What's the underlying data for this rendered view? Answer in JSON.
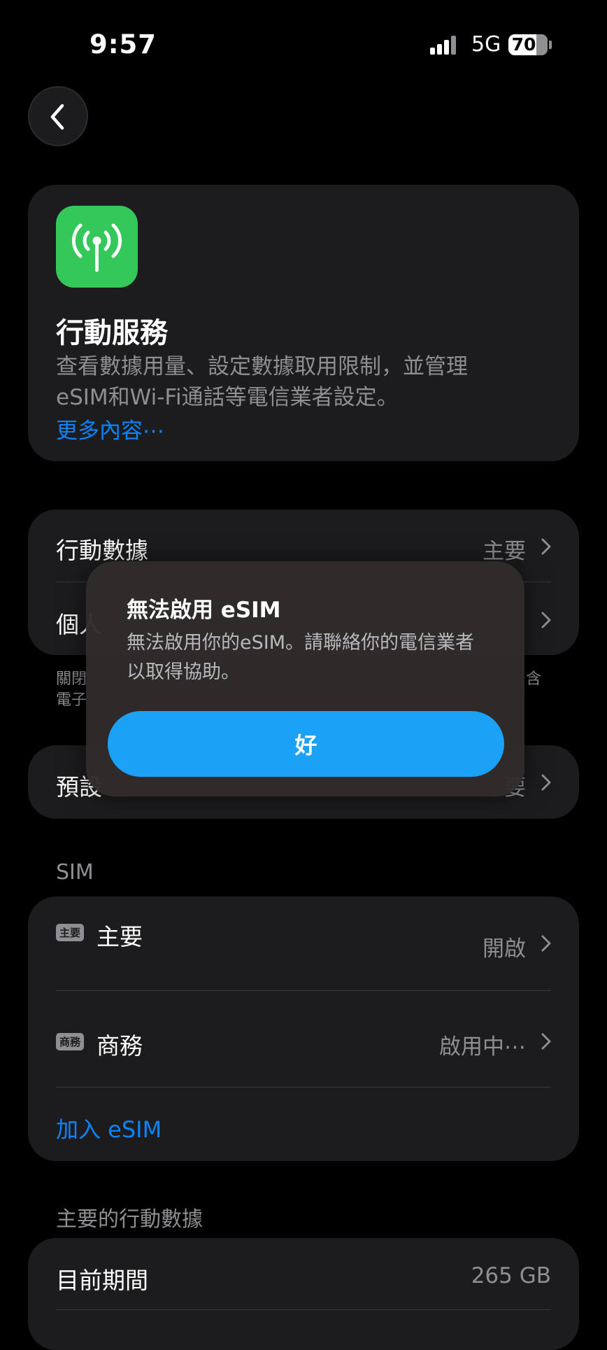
{
  "status_bar": {
    "time": "9:57",
    "network": "5G",
    "battery": "70"
  },
  "hero": {
    "title": "行動服務",
    "description": "查看數據用量、設定數據取用限制，並管理 eSIM和Wi‑Fi通話等電信業者設定。",
    "more_link": "更多內容⋯"
  },
  "main_list": [
    {
      "label": "行動數據",
      "value": "主要"
    },
    {
      "label": "個人",
      "value": ""
    }
  ],
  "footnote": {
    "line1": "關閉",
    "line2": "電子",
    "tail": "含"
  },
  "default_line": {
    "label": "預設",
    "value": "要"
  },
  "sim_section": {
    "header": "SIM",
    "items": [
      {
        "badge": "主要",
        "label": "主要",
        "value": "開啟"
      },
      {
        "badge": "商務",
        "label": "商務",
        "value": "啟用中⋯"
      }
    ],
    "add_esim": "加入 eSIM"
  },
  "data_section": {
    "header": "主要的行動數據",
    "current_period_label": "目前期間",
    "current_period_value": "265 GB"
  },
  "alert": {
    "title": "無法啟用 eSIM",
    "message": "無法啟用你的eSIM。請聯絡你的電信業者以取得協助。",
    "ok_label": "好"
  },
  "colors": {
    "accent": "#0a84ff",
    "icon_green": "#34c759",
    "alert_button": "#1ba1f5"
  },
  "icons": {
    "back": "chevron-left-icon",
    "app": "antenna-icon",
    "row": "chevron-right-icon"
  }
}
